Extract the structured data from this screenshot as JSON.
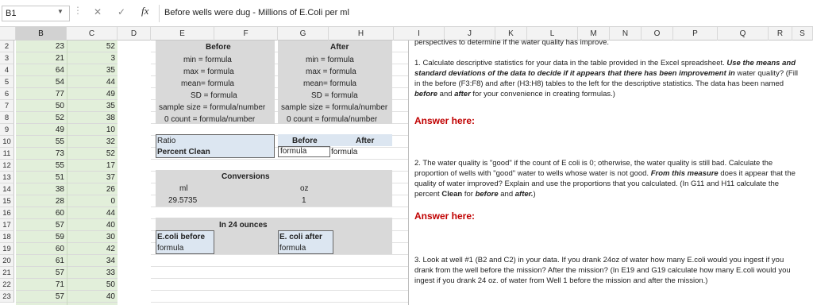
{
  "formula_bar": {
    "name_box": "B1",
    "fx": "fx",
    "formula": "Before wells were dug - Millions of E.Coli per ml"
  },
  "columns": [
    "B",
    "C",
    "D",
    "E",
    "F",
    "G",
    "H",
    "I",
    "J",
    "K",
    "L",
    "M",
    "N",
    "O",
    "P",
    "Q",
    "R",
    "S"
  ],
  "rows": [
    "2",
    "3",
    "4",
    "5",
    "6",
    "7",
    "8",
    "9",
    "10",
    "11",
    "12",
    "13",
    "14",
    "15",
    "16",
    "17",
    "18",
    "19",
    "20",
    "21",
    "22",
    "23"
  ],
  "col_b": [
    "23",
    "21",
    "64",
    "54",
    "77",
    "50",
    "52",
    "49",
    "55",
    "73",
    "55",
    "51",
    "38",
    "28",
    "60",
    "57",
    "59",
    "60",
    "61",
    "57",
    "71",
    "57"
  ],
  "col_c": [
    "52",
    "3",
    "35",
    "44",
    "49",
    "35",
    "38",
    "10",
    "32",
    "52",
    "17",
    "37",
    "26",
    "0",
    "44",
    "40",
    "30",
    "42",
    "34",
    "33",
    "50",
    "40"
  ],
  "stats": {
    "before_header": "Before",
    "after_header": "After",
    "before": [
      "min = formula",
      "max = formula",
      "mean= formula",
      "SD = formula",
      "sample size = formula/number",
      "0 count = formula/number"
    ],
    "after": [
      "min = formula",
      "max = formula",
      "mean= formula",
      "SD = formula",
      "sample size = formula/number",
      "0 count = formula/number"
    ]
  },
  "ratio": {
    "ratio_label": "Ratio",
    "percent_label": "Percent Clean",
    "before_header": "Before",
    "after_header": "After",
    "before_value": "formula",
    "after_value": "formula"
  },
  "conversions": {
    "title": "Conversions",
    "ml_label": "ml",
    "oz_label": "oz",
    "ml_value": "29.5735",
    "oz_value": "1"
  },
  "ounces": {
    "title": "In 24 ounces",
    "before_label": "E.coli before",
    "after_label": "E. coli after",
    "before_value": "formula",
    "after_value": "formula"
  },
  "questions": {
    "header_fragment": "perspectives to determine if the water quality has improve.",
    "q1_a": "1. Calculate descriptive statistics for your data in the table provided in the Excel spreadsheet. ",
    "q1_b": "Use the means and standard deviations of the data to decide if it appears that there has been improvement in",
    "q1_c": " water quality? (Fill in the before (F3:F8) and after (H3:H8) tables to the left for the descriptive statistics. The data has been named ",
    "q1_before": "before",
    "q1_and": " and ",
    "q1_after": "after",
    "q1_d": " for your convenience in creating formulas.)",
    "answer1": "Answer here:",
    "q2_a": "2. The water quality is \"good\" if the count of E coli is 0; otherwise, the water quality is still bad. Calculate the proportion of wells with \"good\" water to wells whose water is not good. ",
    "q2_b": "From this measure",
    "q2_c": " does it appear that the quality of water improved? Explain and use the proportions that you calculated. (In G11 and H11 calculate the percent ",
    "q2_clean": "Clean",
    "q2_for": " for ",
    "q2_before": "before",
    "q2_and": " and ",
    "q2_after": "after.",
    "q2_d": ")",
    "answer2": "Answer here:",
    "q3": "3. Look at well #1 (B2 and C2) in your data. If you drank 24oz of water how many E.coli would you ingest if you drank from the well before the mission? After the mission? (In E19 and G19 calculate how many E.coli would you ingest if you drank  24 oz. of water from Well 1 before the mission and  after the mission.)"
  }
}
